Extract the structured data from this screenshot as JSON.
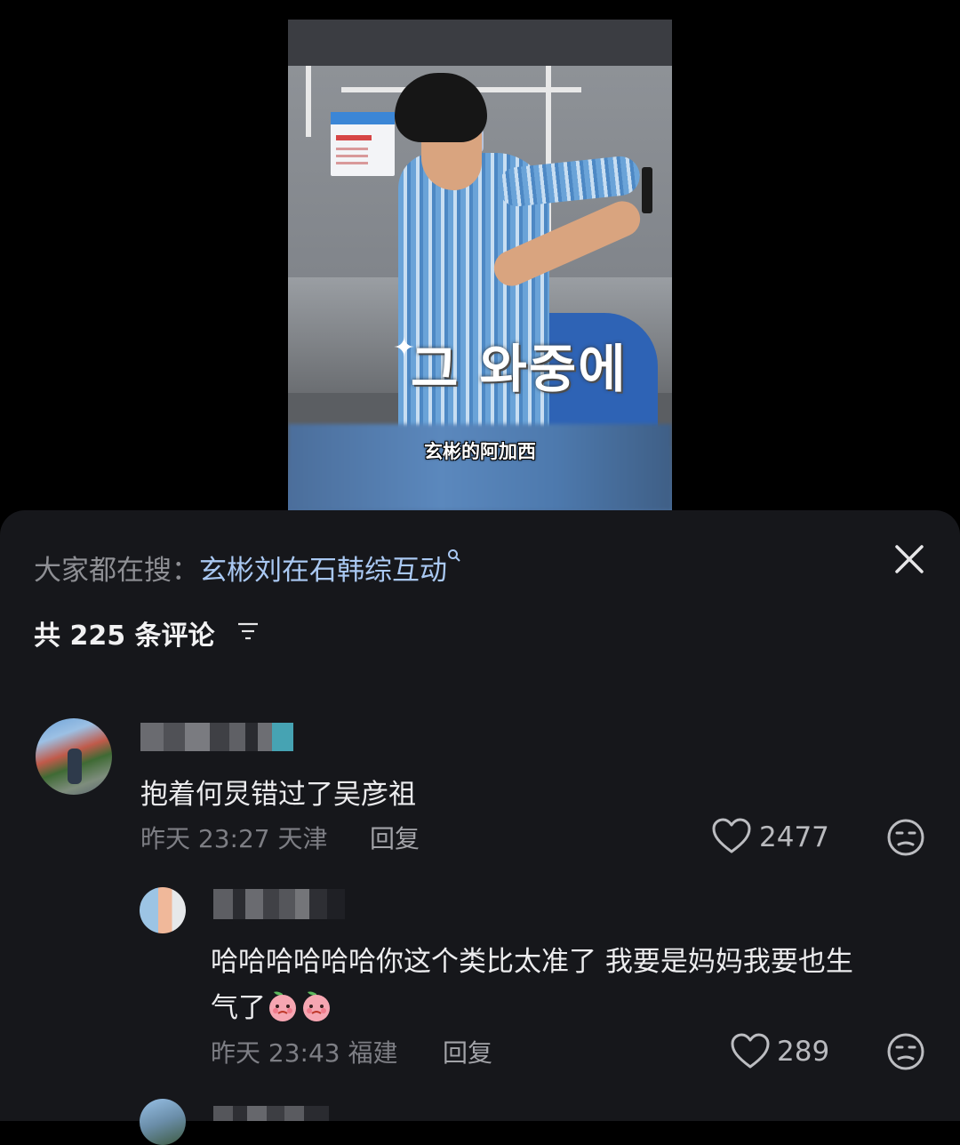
{
  "video": {
    "overlay_text": "그 와중에",
    "caption": "玄彬的阿加西"
  },
  "search": {
    "prefix": "大家都在搜：",
    "term": "玄彬刘在石韩综互动"
  },
  "comments_header": {
    "count_text": "共 225 条评论"
  },
  "comments": [
    {
      "text": "抱着何炅错过了吴彦祖",
      "time": "昨天 23:27",
      "location": "天津",
      "reply_label": "回复",
      "likes": "2477"
    },
    {
      "text_line1": "哈哈哈哈哈哈你这个类比太准了 我要是妈妈我要也生",
      "text_line2": "气了",
      "time": "昨天 23:43",
      "location": "福建",
      "reply_label": "回复",
      "likes": "289"
    }
  ],
  "icons": {
    "close": "close-icon",
    "sort": "sort-filter-icon",
    "like": "heart-outline-icon",
    "dislike": "unamused-face-icon",
    "search_hint": "search-magnifier-icon",
    "reaction": "peach-emoji-icon"
  },
  "colors": {
    "sheet_bg": "#16171b",
    "search_term": "#a9c8f2",
    "meta_text": "#7d7e84"
  }
}
